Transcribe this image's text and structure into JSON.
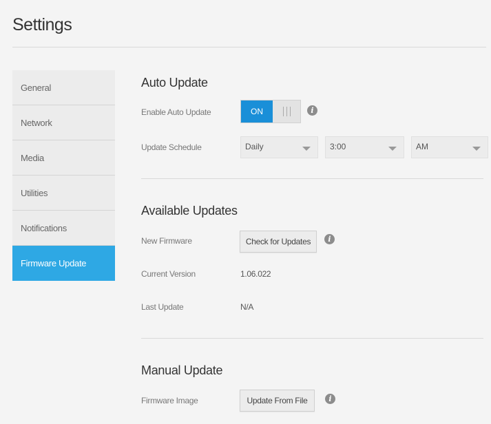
{
  "page": {
    "title": "Settings"
  },
  "sidebar": {
    "items": [
      {
        "label": "General"
      },
      {
        "label": "Network"
      },
      {
        "label": "Media"
      },
      {
        "label": "Utilities"
      },
      {
        "label": "Notifications"
      },
      {
        "label": "Firmware Update",
        "active": true
      }
    ]
  },
  "auto_update": {
    "title": "Auto Update",
    "enable_label": "Enable Auto Update",
    "toggle_state": "ON",
    "schedule_label": "Update Schedule",
    "frequency": "Daily",
    "time": "3:00",
    "ampm": "AM"
  },
  "available_updates": {
    "title": "Available Updates",
    "new_firmware_label": "New Firmware",
    "check_button": "Check for Updates",
    "current_version_label": "Current Version",
    "current_version": "1.06.022",
    "last_update_label": "Last Update",
    "last_update": "N/A"
  },
  "manual_update": {
    "title": "Manual Update",
    "firmware_image_label": "Firmware Image",
    "update_button": "Update From File"
  },
  "colors": {
    "accent": "#2ea8e4",
    "toggle_on": "#1a8fd8",
    "background": "#f4f4f4"
  },
  "icons": {
    "info": "info-icon",
    "dropdown": "chevron-down-icon"
  }
}
